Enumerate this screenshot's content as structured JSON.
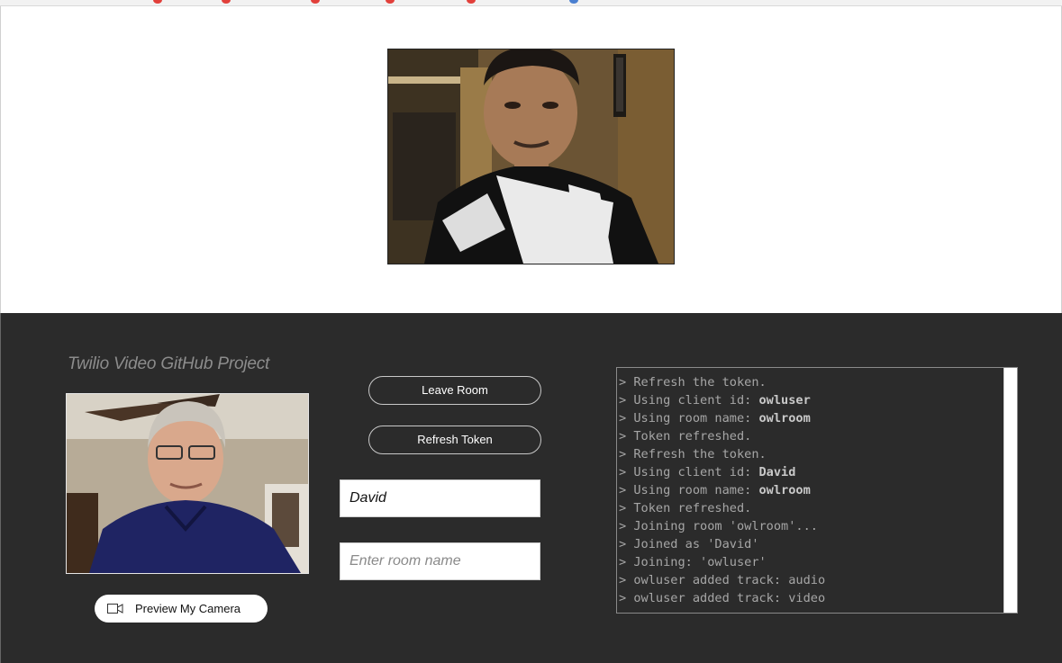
{
  "app": {
    "title": "Twilio Video GitHub Project"
  },
  "controls": {
    "leave_room_label": "Leave Room",
    "refresh_token_label": "Refresh Token",
    "preview_camera_label": "Preview My Camera",
    "client_id_value": "David",
    "room_name_value": "",
    "room_name_placeholder": "Enter room name"
  },
  "log": {
    "lines": [
      {
        "text": "> Refresh the token.",
        "bold": ""
      },
      {
        "text": "> Using client id: ",
        "bold": "owluser"
      },
      {
        "text": "> Using room name: ",
        "bold": "owlroom"
      },
      {
        "text": "> Token refreshed.",
        "bold": ""
      },
      {
        "text": "> Refresh the token.",
        "bold": ""
      },
      {
        "text": "> Using client id: ",
        "bold": "David"
      },
      {
        "text": "> Using room name: ",
        "bold": "owlroom"
      },
      {
        "text": "> Token refreshed.",
        "bold": ""
      },
      {
        "text": "> Joining room 'owlroom'...",
        "bold": ""
      },
      {
        "text": "> Joined as 'David'",
        "bold": ""
      },
      {
        "text": "> Joining: 'owluser'",
        "bold": ""
      },
      {
        "text": "> owluser added track: audio",
        "bold": ""
      },
      {
        "text": "> owluser added track: video",
        "bold": ""
      }
    ]
  },
  "icons": {
    "preview_camera": "video-camera-icon"
  },
  "colors": {
    "panel_background": "#2b2b2b",
    "title_text": "#8c8c8c",
    "log_text": "#a6a6a6"
  }
}
